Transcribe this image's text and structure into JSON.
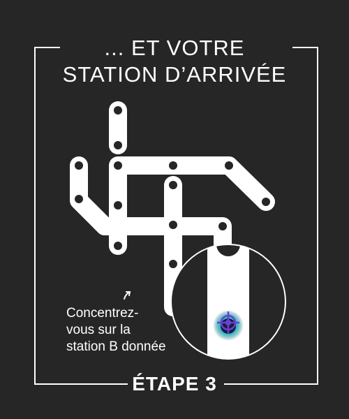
{
  "title": {
    "line1": "... ET VOTRE",
    "line2": "STATION D’ARRIVÉE"
  },
  "instruction": {
    "line1": "Concentrez-",
    "line2": "vous sur la",
    "line3": "station B donnée"
  },
  "step": {
    "label": "ÉTAPE 3"
  },
  "colors": {
    "background": "#262626",
    "foreground": "#ffffff",
    "target_ring": "#6a3fd1",
    "target_glow": "#18d0d0"
  },
  "icons": {
    "target": "crosshair-target-icon",
    "pointer": "curved-arrow-icon"
  }
}
